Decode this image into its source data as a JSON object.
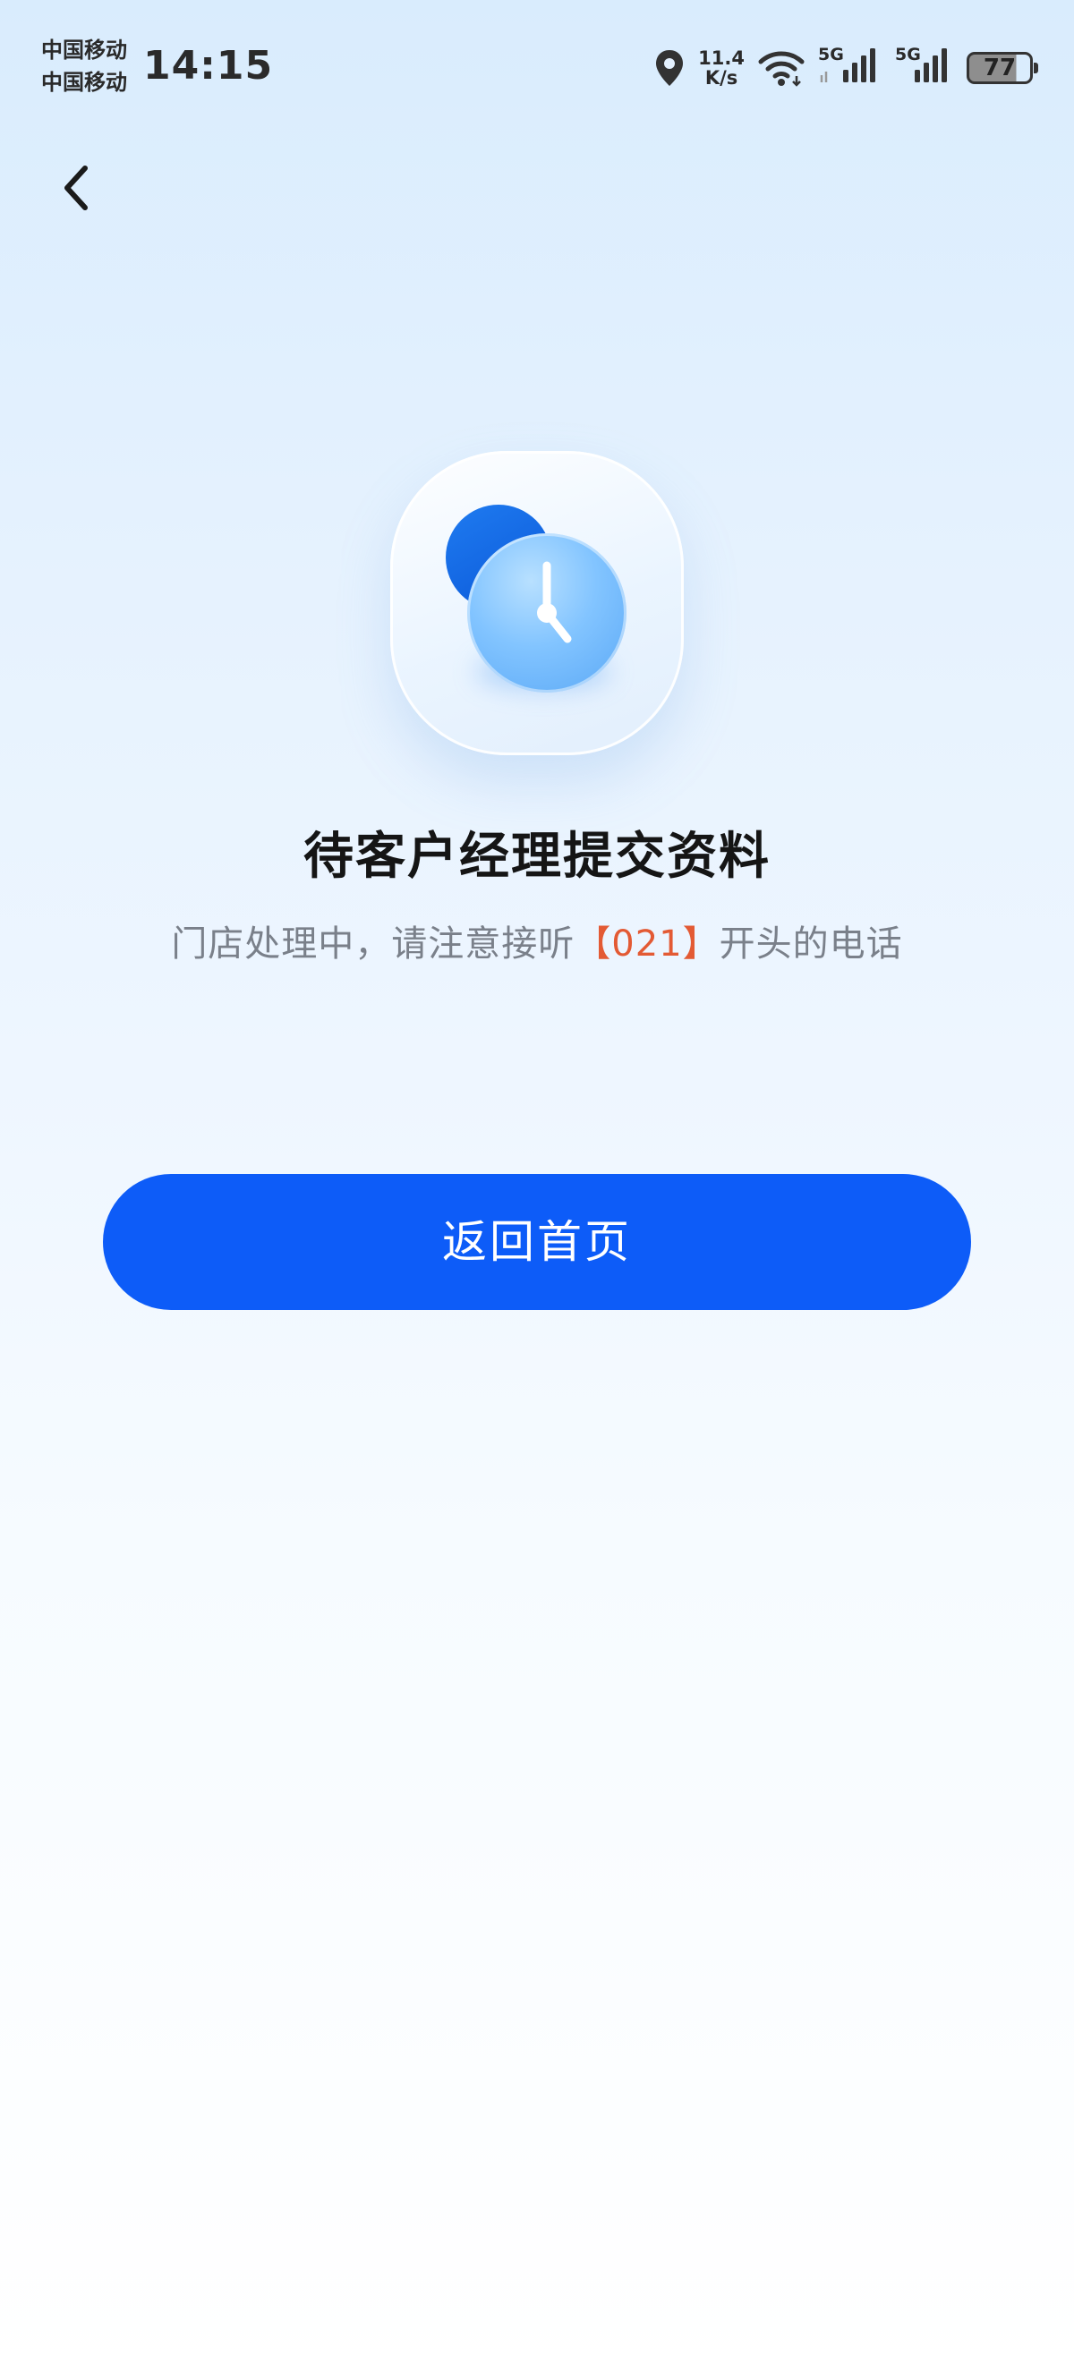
{
  "status_bar": {
    "carrier_1": "中国移动",
    "carrier_2": "中国移动",
    "time": "14:15",
    "net_speed_value": "11.4",
    "net_speed_unit": "K/s",
    "sim1_network": "5G",
    "sim2_network": "5G",
    "battery_level": "77",
    "icons": [
      "location-icon",
      "wifi-icon",
      "signal-icon",
      "signal-icon",
      "battery-icon"
    ]
  },
  "nav": {
    "back_icon": "chevron-left-icon"
  },
  "status": {
    "icon": "clock-icon",
    "title": "待客户经理提交资料",
    "subtitle_before": "门店处理中，请注意接听",
    "subtitle_highlight": "【021】",
    "subtitle_after": "开头的电话"
  },
  "actions": {
    "home_button_label": "返回首页"
  },
  "colors": {
    "primary": "#0D5CF8",
    "highlight": "#E35A34",
    "subtitle_text": "#7A808A",
    "title_text": "#151515"
  }
}
